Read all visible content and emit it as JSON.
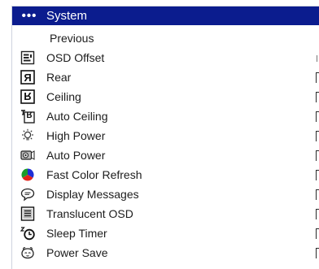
{
  "menu": {
    "header": {
      "dots": "•••",
      "title": "System"
    },
    "items": [
      {
        "label": "Previous",
        "icon": "none",
        "has_value": false
      },
      {
        "label": "OSD Offset",
        "icon": "osd-offset-icon",
        "has_value": false
      },
      {
        "label": "Rear",
        "icon": "rear-projection-icon",
        "has_value": true
      },
      {
        "label": "Ceiling",
        "icon": "ceiling-mount-icon",
        "has_value": true
      },
      {
        "label": "Auto Ceiling",
        "icon": "auto-ceiling-icon",
        "has_value": true
      },
      {
        "label": "High Power",
        "icon": "lightbulb-icon",
        "has_value": true
      },
      {
        "label": "Auto Power",
        "icon": "auto-power-icon",
        "has_value": true
      },
      {
        "label": "Fast Color Refresh",
        "icon": "color-wheel-icon",
        "has_value": true
      },
      {
        "label": "Display Messages",
        "icon": "message-bubble-icon",
        "has_value": true
      },
      {
        "label": "Translucent OSD",
        "icon": "translucent-osd-icon",
        "has_value": true
      },
      {
        "label": "Sleep Timer",
        "icon": "sleep-timer-icon",
        "has_value": true
      },
      {
        "label": "Power Save",
        "icon": "power-save-icon",
        "has_value": true
      }
    ]
  },
  "colors": {
    "header_background": "#0b1c8e",
    "header_text": "#ffffff",
    "item_text": "#1c1c1c",
    "color_wheel_blue": "#1f2ed6",
    "color_wheel_red": "#e2231a",
    "color_wheel_green": "#1a9b2b"
  }
}
